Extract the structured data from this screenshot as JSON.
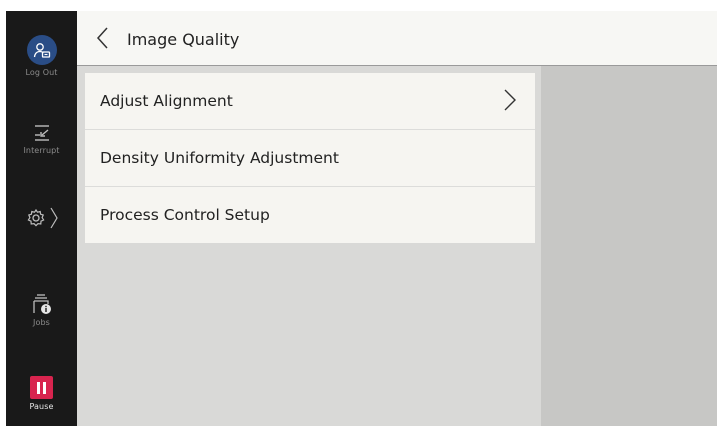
{
  "sidebar": {
    "logout": {
      "label": "Log Out",
      "icon": "user-logout-icon"
    },
    "interrupt": {
      "label": "Interrupt",
      "icon": "interrupt-icon"
    },
    "settings": {
      "icon": "gear-icon"
    },
    "jobs": {
      "label": "Jobs",
      "icon": "jobs-icon"
    },
    "pause": {
      "label": "Pause",
      "icon": "pause-icon",
      "color": "#d8244e"
    }
  },
  "header": {
    "title": "Image Quality",
    "back_icon": "chevron-left-icon"
  },
  "menu": {
    "items": [
      {
        "label": "Adjust Alignment",
        "has_chevron": true
      },
      {
        "label": "Density Uniformity Adjustment",
        "has_chevron": false
      },
      {
        "label": "Process Control Setup",
        "has_chevron": false
      }
    ]
  },
  "colors": {
    "sidebar_bg": "#191919",
    "logout_accent": "#2a4d86",
    "pause_accent": "#d8244e",
    "content_bg": "#d9d9d7",
    "right_pane_bg": "#c7c7c5"
  }
}
